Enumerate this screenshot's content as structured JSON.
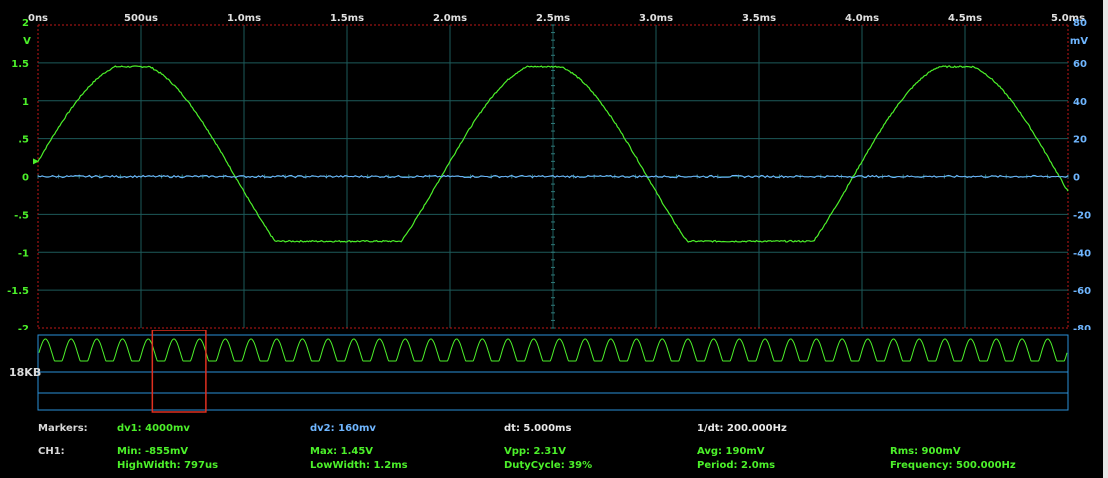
{
  "chart_data": {
    "type": "line",
    "x_unit": "ms",
    "xlim": [
      0,
      5
    ],
    "x_tick_labels": [
      "0ns",
      "500us",
      "1.0ms",
      "1.5ms",
      "2.0ms",
      "2.5ms",
      "3.0ms",
      "3.5ms",
      "4.0ms",
      "4.5ms",
      "5.0ms"
    ],
    "left_axis": {
      "unit": "V",
      "unit_label": "V",
      "ylim": [
        -2,
        2
      ],
      "tick_labels": [
        "2",
        "1.5",
        "1",
        ".5",
        "0",
        "-.5",
        "-1",
        "-1.5",
        "-2"
      ]
    },
    "right_axis": {
      "unit": "mV",
      "unit_label": "mV",
      "ylim": [
        -80,
        80
      ],
      "tick_labels": [
        "80",
        "60",
        "40",
        "20",
        "0",
        "-20",
        "-40",
        "-60",
        "-80"
      ]
    },
    "series": [
      {
        "color": "#4cf02a",
        "axis": "left",
        "waveform": "clipped-sine",
        "frequency_hz": 500,
        "clip_max": 1.45,
        "clip_min": -0.855,
        "amplitude": 1.5,
        "start_value": 0.2
      },
      {
        "color": "#6fb6ff",
        "axis": "right",
        "waveform": "flat-noise",
        "value": 0
      }
    ],
    "grid": true,
    "trigger_marker": {
      "value": 0.2,
      "color": "#4cf02a"
    }
  },
  "overview": {
    "buffer_label": "18KB",
    "cycles": 40,
    "selection": {
      "start_fraction": 0.111,
      "end_fraction": 0.163
    },
    "colors": {
      "selection": "#e03020",
      "trace": "#4cf02a",
      "frame": "#2a8fd8"
    }
  },
  "measurements": {
    "markers_label": "Markers:",
    "dv1": "dv1: 4000mv",
    "dv2": "dv2: 160mv",
    "dt": "dt: 5.000ms",
    "inv_dt": "1/dt: 200.000Hz",
    "ch1_label": "CH1:",
    "min": "Min: -855mV",
    "max": "Max: 1.45V",
    "vpp": "Vpp: 2.31V",
    "avg": "Avg: 190mV",
    "rms": "Rms: 900mV",
    "high_width": "HighWidth: 797us",
    "low_width": "LowWidth: 1.2ms",
    "duty_cycle": "DutyCycle: 39%",
    "period": "Period: 2.0ms",
    "frequency": "Frequency: 500.000Hz"
  }
}
